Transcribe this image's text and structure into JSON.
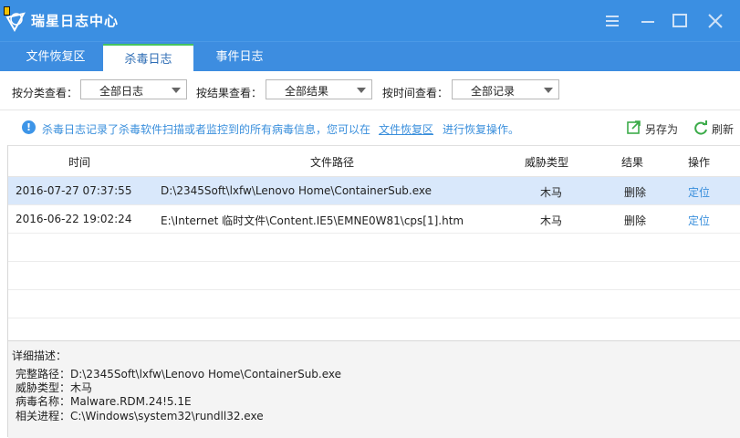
{
  "titlebar": {
    "title": "瑞星日志中心",
    "menu_icon": "menu-icon",
    "min_icon": "minimize-icon",
    "max_icon": "maximize-icon",
    "close_icon": "close-icon",
    "bg_color": "#3b8fe2"
  },
  "tabs": [
    {
      "label": "文件恢复区",
      "active": false
    },
    {
      "label": "杀毒日志",
      "active": true
    },
    {
      "label": "事件日志",
      "active": false
    }
  ],
  "filters": {
    "category_label": "按分类查看：",
    "category_value": "全部日志",
    "result_label": "按结果查看：",
    "result_value": "全部结果",
    "time_label": "按时间查看：",
    "time_value": "全部记录"
  },
  "info": {
    "text_before": "杀毒日志记录了杀毒软件扫描或者监控到的所有病毒信息，您可以在",
    "link": "文件恢复区",
    "text_after": "进行恢复操作。",
    "save_as": "另存为",
    "refresh": "刷新"
  },
  "table": {
    "headers": [
      "时间",
      "文件路径",
      "威胁类型",
      "结果",
      "操作"
    ],
    "rows": [
      {
        "time": "2016-07-27 07:37:55",
        "path": "D:\\2345Soft\\lxfw\\Lenovo Home\\ContainerSub.exe",
        "threat": "木马",
        "result": "删除",
        "action": "定位",
        "selected": true
      },
      {
        "time": "2016-06-22 19:02:24",
        "path": "E:\\Internet 临时文件\\Content.IE5\\EMNE0W81\\cps[1].htm",
        "threat": "木马",
        "result": "删除",
        "action": "定位",
        "selected": false
      }
    ]
  },
  "detail": {
    "heading": "详细描述：",
    "full_path": "完整路径：D:\\2345Soft\\lxfw\\Lenovo Home\\ContainerSub.exe",
    "threat_type": "威胁类型：木马",
    "virus_name": "病毒名称：Malware.RDM.24!5.1E",
    "process": "相关进程：C:\\Windows\\system32\\rundll32.exe"
  },
  "colors": {
    "accent": "#3b8fe2",
    "link": "#3a8fdc",
    "selected_row": "#d9e8fb",
    "tab_active_border": "#45c35f"
  }
}
